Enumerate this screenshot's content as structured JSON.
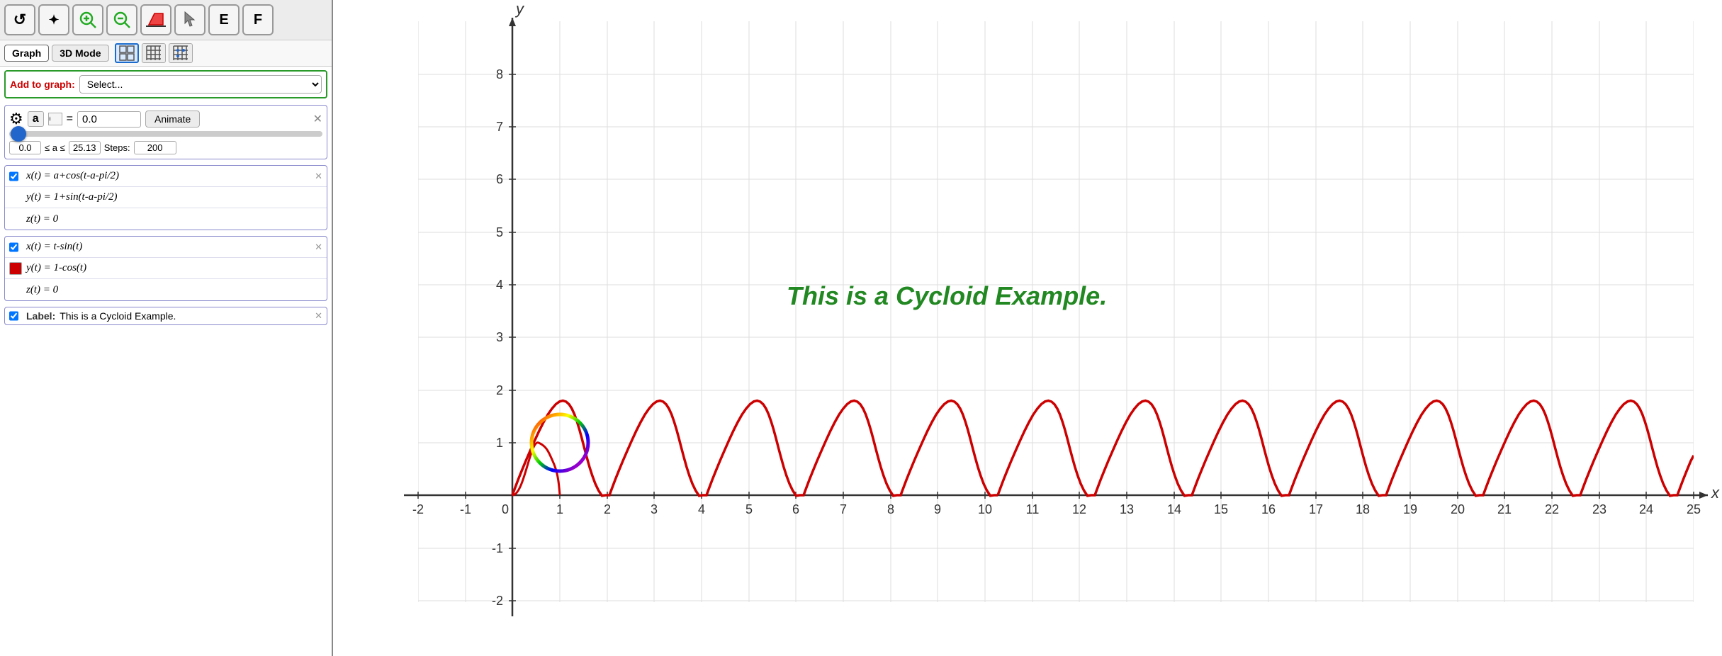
{
  "toolbar": {
    "buttons": [
      {
        "name": "refresh",
        "icon": "↺"
      },
      {
        "name": "scatter",
        "icon": "✦"
      },
      {
        "name": "zoom-in",
        "icon": "🔍+"
      },
      {
        "name": "zoom-out",
        "icon": "🔍-"
      },
      {
        "name": "erase",
        "icon": "⌫"
      },
      {
        "name": "pointer",
        "icon": "↗"
      },
      {
        "name": "E",
        "label": "E"
      },
      {
        "name": "F",
        "label": "F"
      }
    ]
  },
  "mode_tabs": {
    "tabs": [
      "Graph",
      "3D Mode"
    ],
    "active": "Graph",
    "icons": [
      "grid1",
      "grid2",
      "grid3"
    ]
  },
  "add_to_graph": {
    "label": "Add to graph:",
    "placeholder": "Select..."
  },
  "parameter": {
    "name": "a",
    "value": "0.0",
    "animate_label": "Animate",
    "min": "0.0",
    "max": "25.13",
    "steps_label": "Steps:",
    "steps": "200"
  },
  "equations": [
    {
      "id": "eq1",
      "checked": true,
      "color": null,
      "lines": [
        "x(t) = a+cos(t-a-pi/2)",
        "y(t) = 1+sin(t-a-pi/2)",
        "z(t) = 0"
      ]
    },
    {
      "id": "eq2",
      "checked": true,
      "color": "#cc0000",
      "lines": [
        "x(t) = t-sin(t)",
        "y(t) = 1-cos(t)",
        "z(t) = 0"
      ]
    }
  ],
  "label": {
    "key": "Label:",
    "value": "This is a Cycloid Example."
  },
  "graph": {
    "title": "This is a Cycloid Example.",
    "x_label": "x",
    "y_label": "y",
    "x_min": -2,
    "x_max": 25,
    "y_min": -2,
    "y_max": 9,
    "x_ticks": [
      -2,
      -1,
      1,
      2,
      3,
      4,
      5,
      6,
      7,
      8,
      9,
      10,
      11,
      12,
      13,
      14,
      15,
      16,
      17,
      18,
      19,
      20,
      21,
      22,
      23,
      24,
      25
    ],
    "y_ticks": [
      -2,
      -1,
      1,
      2,
      3,
      4,
      5,
      6,
      7,
      8
    ]
  }
}
